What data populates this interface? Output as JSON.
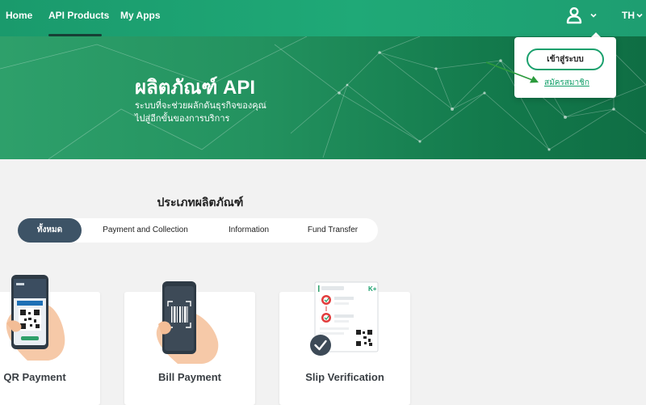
{
  "nav": {
    "items": [
      {
        "label": "Home"
      },
      {
        "label": "API Products"
      },
      {
        "label": "My Apps"
      }
    ],
    "lang": "TH"
  },
  "hero": {
    "title": "ผลิตภัณฑ์ API",
    "subtitle_line1": "ระบบที่จะช่วยผลักดันธุรกิจของคุณ",
    "subtitle_line2": "ไปสู่อีกขั้นของการบริการ"
  },
  "dropdown": {
    "login": "เข้าสู่ระบบ",
    "register": "สมัครสมาชิก"
  },
  "products": {
    "section_title": "ประเภทผลิตภัณฑ์",
    "filters": [
      {
        "label": "ทั้งหมด",
        "active": true
      },
      {
        "label": "Payment and Collection",
        "active": false
      },
      {
        "label": "Information",
        "active": false
      },
      {
        "label": "Fund Transfer",
        "active": false
      }
    ],
    "cards": [
      {
        "title": "QR Payment"
      },
      {
        "title": "Bill Payment"
      },
      {
        "title": "Slip Verification"
      }
    ]
  },
  "colors": {
    "brand_green": "#1fa977",
    "active_filter": "#3d5366",
    "link_green": "#14a06a"
  }
}
